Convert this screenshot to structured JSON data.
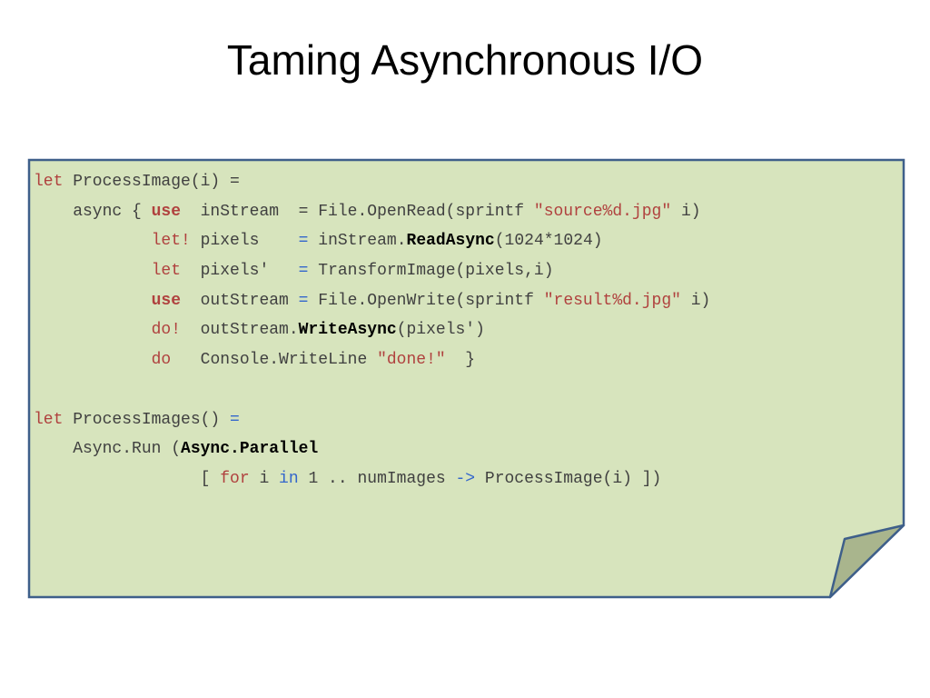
{
  "slide": {
    "title": "Taming Asynchronous I/O"
  },
  "colors": {
    "note_fill": "#d7e4bd",
    "note_border": "#3e5f8a",
    "fold_fill": "#a9b58d",
    "keyword": "#b0413e",
    "operator": "#3366cc",
    "text": "#404040"
  },
  "code": {
    "lines": [
      [
        {
          "t": "let",
          "k": "kw"
        },
        {
          "t": " ProcessImage(i) =",
          "k": "plain"
        }
      ],
      [
        {
          "t": "    async { ",
          "k": "plain"
        },
        {
          "t": "use",
          "k": "kwb"
        },
        {
          "t": "  inStream  = File.OpenRead(sprintf ",
          "k": "plain"
        },
        {
          "t": "\"source%d.jpg\"",
          "k": "str"
        },
        {
          "t": " i)",
          "k": "plain"
        }
      ],
      [
        {
          "t": "            ",
          "k": "plain"
        },
        {
          "t": "let!",
          "k": "kw"
        },
        {
          "t": " pixels    ",
          "k": "plain"
        },
        {
          "t": "=",
          "k": "op"
        },
        {
          "t": " inStream.",
          "k": "plain"
        },
        {
          "t": "ReadAsync",
          "k": "bold"
        },
        {
          "t": "(1024*1024)",
          "k": "plain"
        }
      ],
      [
        {
          "t": "            ",
          "k": "plain"
        },
        {
          "t": "let",
          "k": "kw"
        },
        {
          "t": "  pixels'   ",
          "k": "plain"
        },
        {
          "t": "=",
          "k": "op"
        },
        {
          "t": " TransformImage(pixels,i)",
          "k": "plain"
        }
      ],
      [
        {
          "t": "            ",
          "k": "plain"
        },
        {
          "t": "use",
          "k": "kwb"
        },
        {
          "t": "  outStream ",
          "k": "plain"
        },
        {
          "t": "=",
          "k": "op"
        },
        {
          "t": " File.OpenWrite(sprintf ",
          "k": "plain"
        },
        {
          "t": "\"result%d.jpg\"",
          "k": "str"
        },
        {
          "t": " i)",
          "k": "plain"
        }
      ],
      [
        {
          "t": "            ",
          "k": "plain"
        },
        {
          "t": "do!",
          "k": "kw"
        },
        {
          "t": "  outStream.",
          "k": "plain"
        },
        {
          "t": "WriteAsync",
          "k": "bold"
        },
        {
          "t": "(pixels')",
          "k": "plain"
        }
      ],
      [
        {
          "t": "            ",
          "k": "plain"
        },
        {
          "t": "do",
          "k": "kw"
        },
        {
          "t": "   Console.WriteLine ",
          "k": "plain"
        },
        {
          "t": "\"done!\"",
          "k": "str"
        },
        {
          "t": "  }",
          "k": "plain"
        }
      ],
      [
        {
          "t": "",
          "k": "plain"
        }
      ],
      [
        {
          "t": "let",
          "k": "kw"
        },
        {
          "t": " ProcessImages() ",
          "k": "plain"
        },
        {
          "t": "=",
          "k": "op"
        }
      ],
      [
        {
          "t": "    Async.Run (",
          "k": "plain"
        },
        {
          "t": "Async.Parallel",
          "k": "bold"
        }
      ],
      [
        {
          "t": "                 [ ",
          "k": "plain"
        },
        {
          "t": "for",
          "k": "kw"
        },
        {
          "t": " i ",
          "k": "plain"
        },
        {
          "t": "in",
          "k": "op"
        },
        {
          "t": " 1 .. numImages ",
          "k": "plain"
        },
        {
          "t": "->",
          "k": "op"
        },
        {
          "t": " ProcessImage(i) ])",
          "k": "plain"
        }
      ]
    ]
  }
}
